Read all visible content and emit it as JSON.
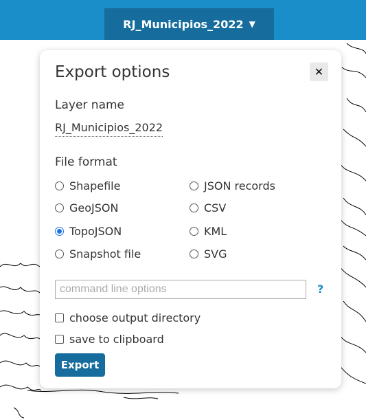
{
  "header": {
    "layer_label": "RJ_Municipios_2022",
    "caret": "▼"
  },
  "dialog": {
    "title": "Export options",
    "close_label": "✕",
    "layer_name_label": "Layer name",
    "layer_name_value": "RJ_Municipios_2022",
    "file_format_label": "File format",
    "formats": [
      {
        "label": "Shapefile",
        "checked": false
      },
      {
        "label": "JSON records",
        "checked": false
      },
      {
        "label": "GeoJSON",
        "checked": false
      },
      {
        "label": "CSV",
        "checked": false
      },
      {
        "label": "TopoJSON",
        "checked": true
      },
      {
        "label": "KML",
        "checked": false
      },
      {
        "label": "Snapshot file",
        "checked": false
      },
      {
        "label": "SVG",
        "checked": false
      }
    ],
    "cmd_placeholder": "command line options",
    "help_label": "?",
    "choose_dir_label": "choose output directory",
    "clipboard_label": "save to clipboard",
    "export_label": "Export"
  },
  "colors": {
    "accent": "#1a8ec8",
    "button": "#166d9d",
    "radio_selected": "#1a73e8"
  }
}
